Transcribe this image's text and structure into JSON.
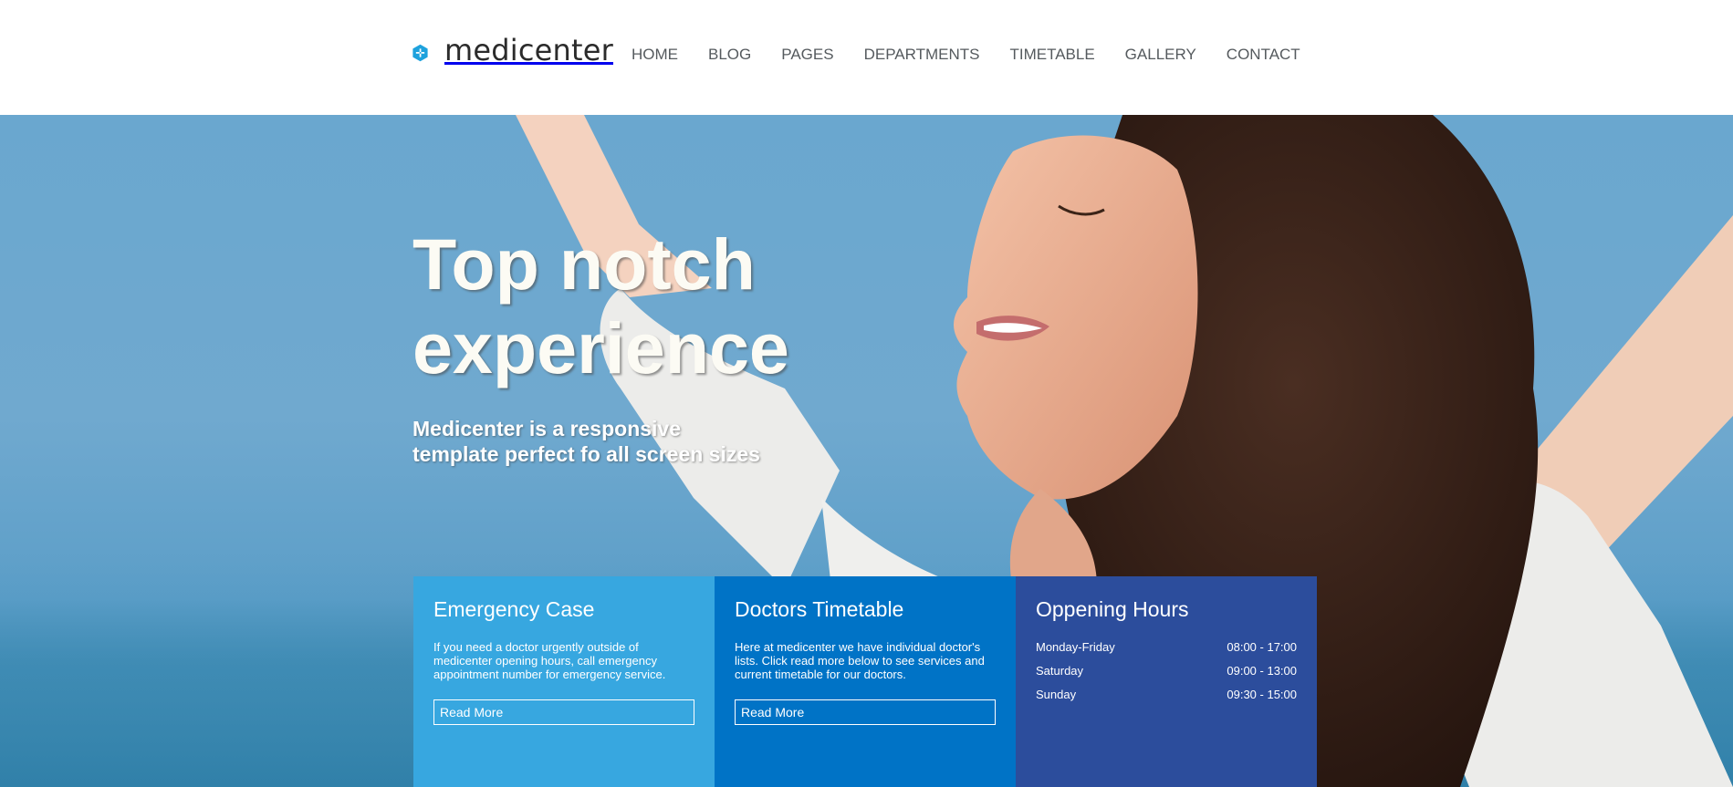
{
  "brand": {
    "name": "medicenter",
    "logo_icon": "hexagon-plus-icon",
    "accent": "#1e9fdb"
  },
  "nav": {
    "items": [
      "HOME",
      "BLOG",
      "PAGES",
      "DEPARTMENTS",
      "TIMETABLE",
      "GALLERY",
      "CONTACT"
    ]
  },
  "hero": {
    "title_line1": "Top notch",
    "title_line2": "experience",
    "subtitle_line1": "Medicenter is a responsive",
    "subtitle_line2": "template perfect fo all screen sizes"
  },
  "boxes": {
    "emergency": {
      "title": "Emergency Case",
      "text_line1": "If you need a doctor urgently outside of",
      "text_line2": "medicenter opening hours, call emergency",
      "text_line3": "appointment number for emergency service.",
      "button": "Read More",
      "color": "#37a7e0"
    },
    "timetable": {
      "title": "Doctors Timetable",
      "text_line1": "Here at medicenter we have individual doctor's",
      "text_line2": "lists. Click read more below to see services and",
      "text_line3": "current timetable for our doctors.",
      "button": "Read More",
      "color": "#0073c6"
    },
    "hours": {
      "title": "Oppening Hours",
      "rows": [
        {
          "day": "Monday-Friday",
          "time": "08:00 - 17:00"
        },
        {
          "day": "Saturday",
          "time": "09:00 - 13:00"
        },
        {
          "day": "Sunday",
          "time": "09:30 - 15:00"
        }
      ],
      "color": "#2c4d9c"
    }
  }
}
